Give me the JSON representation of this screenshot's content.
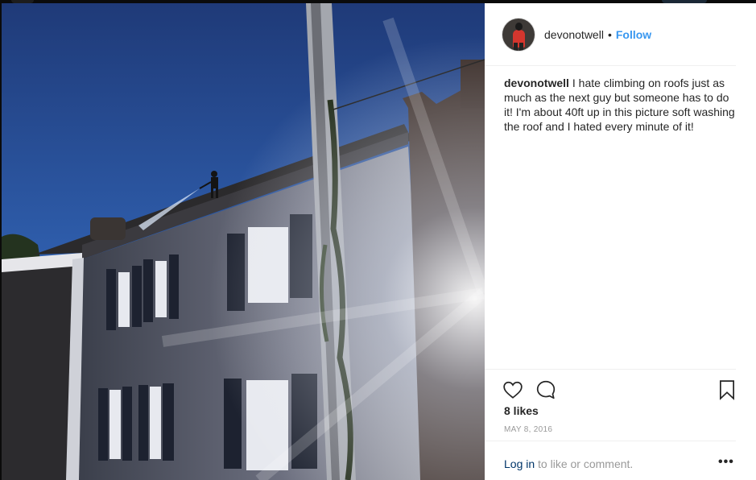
{
  "post": {
    "username": "devonotwell",
    "separator": "•",
    "follow_label": "Follow",
    "caption_user": "devonotwell",
    "caption_text": "I hate climbing on roofs just as much as the next guy but someone has to do it! I'm about 40ft up in this picture soft washing the roof and I hated every minute of it!",
    "likes": "8 likes",
    "date": "MAY 8, 2016",
    "login_link": "Log in",
    "login_suffix": " to like or comment.",
    "more_label": "•••"
  },
  "icons": {
    "like": "heart-icon",
    "comment": "comment-bubble-icon",
    "save": "bookmark-icon",
    "more": "more-options-icon"
  },
  "colors": {
    "link_blue": "#3897f0",
    "login_link": "#003569",
    "text": "#262626",
    "muted": "#999999",
    "divider": "#efefef"
  }
}
